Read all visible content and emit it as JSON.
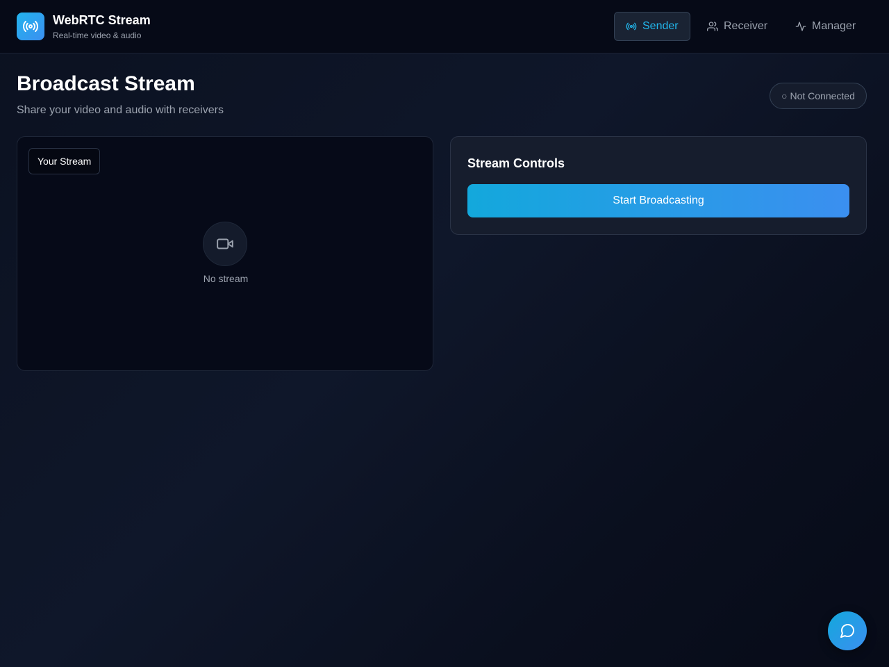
{
  "header": {
    "app_title": "WebRTC Stream",
    "app_subtitle": "Real-time video & audio",
    "logo_icon": "broadcast-icon",
    "nav": [
      {
        "label": "Sender",
        "icon": "broadcast-icon",
        "active": true
      },
      {
        "label": "Receiver",
        "icon": "users-icon",
        "active": false
      },
      {
        "label": "Manager",
        "icon": "activity-icon",
        "active": false
      }
    ]
  },
  "main": {
    "title": "Broadcast Stream",
    "subtitle": "Share your video and audio with receivers",
    "status": "○ Not Connected",
    "video_panel": {
      "label": "Your Stream",
      "placeholder_icon": "video-camera-icon",
      "placeholder_text": "No stream"
    },
    "controls": {
      "title": "Stream Controls",
      "start_button": "Start Broadcasting"
    }
  },
  "chat": {
    "icon": "chat-bubble-icon"
  },
  "colors": {
    "accent": "#22b8ee",
    "button_gradient_start": "#13a8dc",
    "button_gradient_end": "#3b8ff0",
    "background": "#0b1120"
  }
}
